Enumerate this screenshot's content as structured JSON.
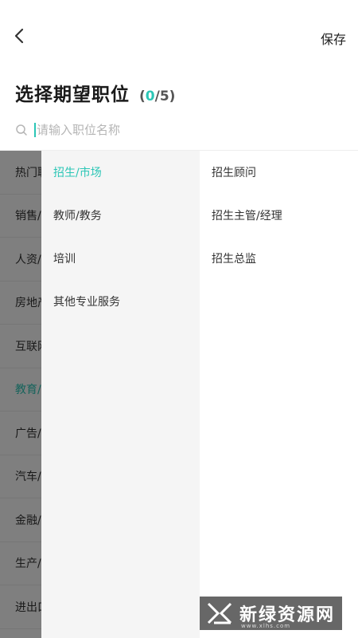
{
  "header": {
    "back_icon": "chevron-left-icon",
    "save_label": "保存"
  },
  "title": {
    "text": "选择期望职位",
    "count_prefix": "(",
    "selected": "0",
    "count_suffix": "/5)"
  },
  "search": {
    "icon": "search-icon",
    "placeholder": "请输入职位名称",
    "value": ""
  },
  "level1": {
    "items": [
      {
        "label": "热门职位"
      },
      {
        "label": "销售/客服"
      },
      {
        "label": "人资/行政"
      },
      {
        "label": "房地产/建筑"
      },
      {
        "label": "互联网/IT"
      },
      {
        "label": "教育/培训",
        "active": true
      },
      {
        "label": "广告/传媒"
      },
      {
        "label": "汽车/交通"
      },
      {
        "label": "金融/保险"
      },
      {
        "label": "生产/制造"
      },
      {
        "label": "进出口/贸易"
      }
    ]
  },
  "level2": {
    "items": [
      {
        "label": "招生/市场",
        "active": true
      },
      {
        "label": "教师/教务"
      },
      {
        "label": "培训"
      },
      {
        "label": "其他专业服务"
      }
    ]
  },
  "level3": {
    "items": [
      {
        "label": "招生顾问"
      },
      {
        "label": "招生主管/经理"
      },
      {
        "label": "招生总监"
      }
    ]
  },
  "watermark": {
    "text": "新绿资源网",
    "sub": "www.xlhs.com"
  },
  "colors": {
    "accent": "#2bc6b6",
    "overlay": "rgba(0,0,0,0.5)",
    "column2_bg": "#f5f5f5"
  }
}
